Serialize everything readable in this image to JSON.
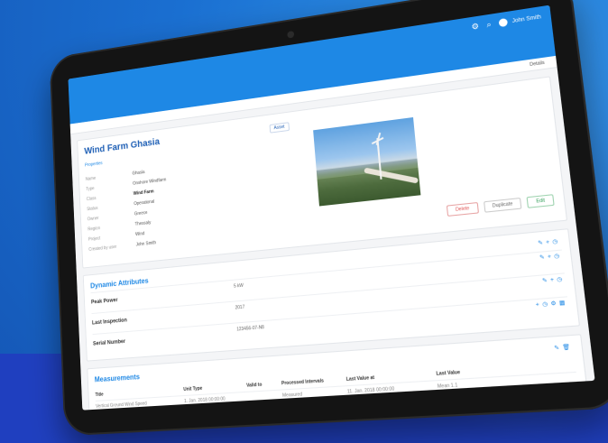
{
  "header": {
    "username": "John Smith",
    "subbar_link": "Details"
  },
  "asset": {
    "title": "Wind Farm Ghasia",
    "badge": "Asset",
    "properties_link": "Properties",
    "properties": [
      {
        "label": "Name",
        "value": "Ghasia"
      },
      {
        "label": "Type",
        "value": "Onshore Windfarm"
      },
      {
        "label": "Class",
        "value": "Wind Farm",
        "strong": true
      },
      {
        "label": "Status",
        "value": "Operational"
      },
      {
        "label": "Owner",
        "value": "Greece"
      },
      {
        "label": "Region",
        "value": "Thessaly"
      },
      {
        "label": "Project",
        "value": "Wind"
      },
      {
        "label": "Created by user",
        "value": "John Smith"
      }
    ],
    "actions": {
      "delete": "Delete",
      "duplicate": "Duplicate",
      "edit": "Edit"
    }
  },
  "dynamic_attributes": {
    "title": "Dynamic Attributes",
    "rows": [
      {
        "label": "Peak Power",
        "value": "5 kW"
      },
      {
        "label": "Last Inspection",
        "value": "2017"
      },
      {
        "label": "Serial Number",
        "value": "123456-07-N8"
      }
    ]
  },
  "measurements": {
    "title": "Measurements",
    "columns": [
      "Title",
      "Unit Type",
      "Valid to",
      "Processed Intervals",
      "Last Value at",
      "Last Value"
    ],
    "rows": [
      [
        "Vertical Ground Wind Speed",
        "1. Jan. 2018 00:00:00",
        "",
        "Measured",
        "11. Jan. 2018 00:00:00",
        "Mean 1.1"
      ]
    ]
  }
}
